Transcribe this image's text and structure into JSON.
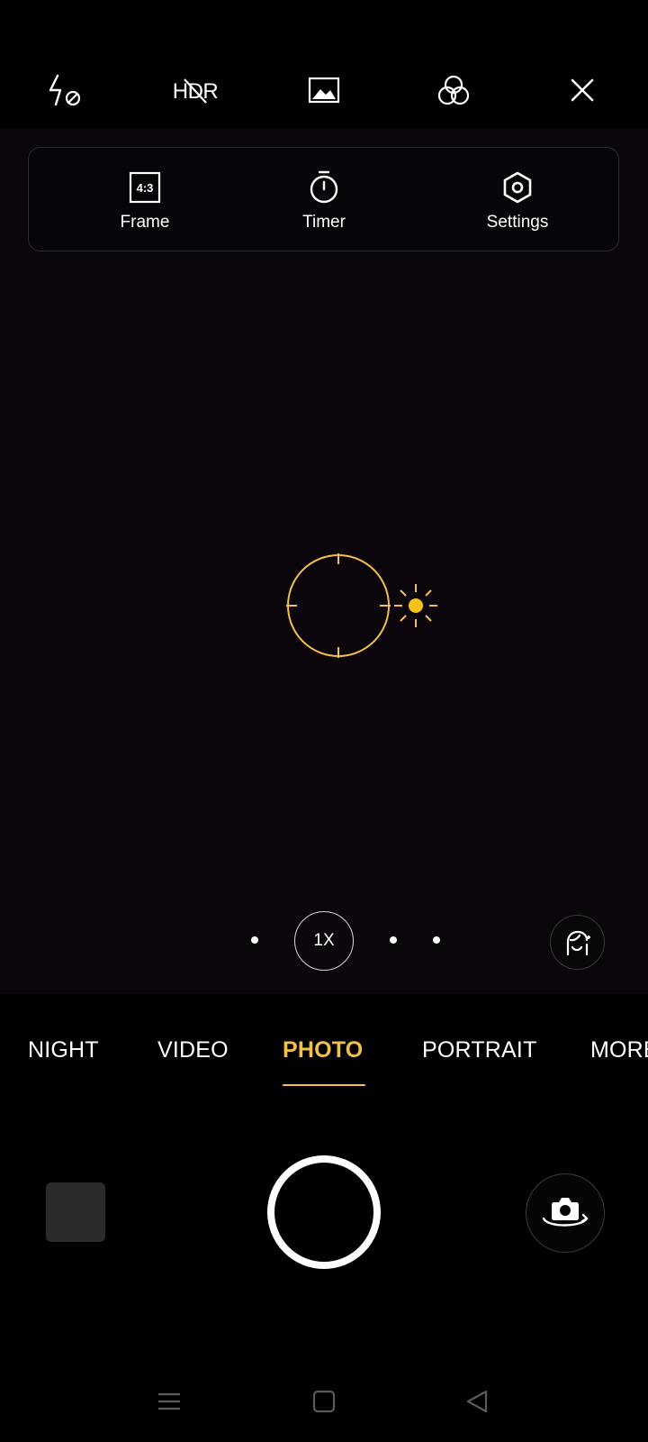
{
  "top_bar": {
    "icons": [
      "flash-off-icon",
      "hdr-off-icon",
      "image-icon",
      "filter-icon",
      "close-icon"
    ]
  },
  "quick_panel": {
    "frame": {
      "icon_text": "4:3",
      "label": "Frame"
    },
    "timer": {
      "label": "Timer"
    },
    "settings": {
      "label": "Settings"
    }
  },
  "focus": {
    "icons": [
      "focus-ring-icon",
      "exposure-sun-icon"
    ],
    "accent": "#f2c04e"
  },
  "zoom": {
    "label": "1X"
  },
  "modes": {
    "items": [
      "NIGHT",
      "VIDEO",
      "PHOTO",
      "PORTRAIT",
      "MORE"
    ],
    "active": "PHOTO",
    "active_color": "#f2c04e"
  },
  "bottom": {
    "icons": [
      "gallery-thumbnail",
      "shutter-button",
      "switch-camera-icon"
    ]
  },
  "navbar": {
    "icons": [
      "menu-icon",
      "home-icon",
      "back-icon"
    ]
  }
}
